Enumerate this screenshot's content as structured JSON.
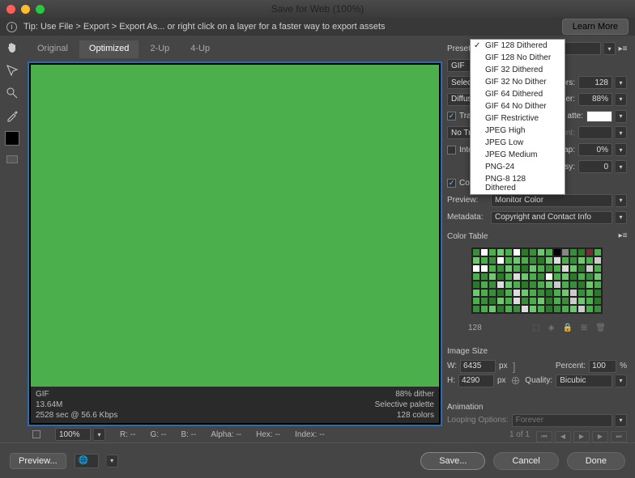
{
  "window": {
    "title": "Save for Web (100%)"
  },
  "tipbar": {
    "text": "Tip: Use File > Export > Export As...  or right click on a layer for a faster way to export assets",
    "learn": "Learn More"
  },
  "tabs": {
    "original": "Original",
    "optimized": "Optimized",
    "two_up": "2-Up",
    "four_up": "4-Up"
  },
  "canvas_info": {
    "format": "GIF",
    "size": "13.64M",
    "time": "2528 sec @ 56.6 Kbps",
    "dither": "88% dither",
    "palette": "Selective palette",
    "colors": "128 colors"
  },
  "readout": {
    "zoom": "100%",
    "r": "R:  --",
    "g": "G:  --",
    "b": "B:  --",
    "alpha": "Alpha:  --",
    "hex": "Hex:  --",
    "index": "Index:  --"
  },
  "preset": {
    "label": "Preset:",
    "format": "GIF",
    "selective_lbl": "Selective",
    "colors_lbl": "ors:",
    "colors_val": "128",
    "diffusion_lbl": "Diffusion",
    "dither_lbl": "her:",
    "dither_val": "88%",
    "transparency_lbl": "Transparency",
    "matte_lbl": "atte:",
    "no_trans_lbl": "No Transparency",
    "amount_lbl": "unt:",
    "interlaced_lbl": "Interlaced",
    "websnap_lbl": "nap:",
    "websnap_val": "0%",
    "lossy_lbl": "ssy:",
    "lossy_val": "0",
    "srgb_lbl": "Convert to sRGB",
    "preview_lbl": "Preview:",
    "preview_val": "Monitor Color",
    "metadata_lbl": "Metadata:",
    "metadata_val": "Copyright and Contact Info"
  },
  "colortable": {
    "header": "Color Table",
    "count": "128"
  },
  "imagesize": {
    "header": "Image Size",
    "w_lbl": "W:",
    "w_val": "6435",
    "px": "px",
    "h_lbl": "H:",
    "h_val": "4290",
    "percent_lbl": "Percent:",
    "percent_val": "100",
    "percent_unit": "%",
    "quality_lbl": "Quality:",
    "quality_val": "Bicubic"
  },
  "animation": {
    "header": "Animation",
    "loop_lbl": "Looping Options:",
    "loop_val": "Forever",
    "count": "1 of 1"
  },
  "footer": {
    "preview": "Preview...",
    "save": "Save...",
    "cancel": "Cancel",
    "done": "Done"
  },
  "dropdown": {
    "items": [
      "GIF 128 Dithered",
      "GIF 128 No Dither",
      "GIF 32 Dithered",
      "GIF 32 No Dither",
      "GIF 64 Dithered",
      "GIF 64 No Dither",
      "GIF Restrictive",
      "JPEG High",
      "JPEG Low",
      "JPEG Medium",
      "PNG-24",
      "PNG-8 128 Dithered"
    ],
    "selected": 0
  },
  "ct_colors": [
    "#3a8d3a",
    "#fff",
    "#4bb04b",
    "#6fc76f",
    "#4bb04b",
    "#fff",
    "#2a7a2a",
    "#3a8d3a",
    "#6fc76f",
    "#4bb04b",
    "#000",
    "#888",
    "#3a8d3a",
    "#2a7a2a",
    "#703030",
    "#4bb04b",
    "#6fc76f",
    "#4bb04b",
    "#3a8d3a",
    "#fff",
    "#4bb04b",
    "#6fc76f",
    "#4bb04b",
    "#3a8d3a",
    "#2a7a2a",
    "#6fc76f",
    "#ddd",
    "#4bb04b",
    "#3a8d3a",
    "#6fc76f",
    "#4bb04b",
    "#ccc",
    "#fff",
    "#fff",
    "#4bb04b",
    "#3a8d3a",
    "#6fc76f",
    "#4bb04b",
    "#2a7a2a",
    "#6fc76f",
    "#4bb04b",
    "#3a8d3a",
    "#4bb04b",
    "#ddd",
    "#6fc76f",
    "#2a7a2a",
    "#ccc",
    "#4bb04b",
    "#4bb04b",
    "#3a8d3a",
    "#6fc76f",
    "#2a7a2a",
    "#4bb04b",
    "#ddd",
    "#6fc76f",
    "#4bb04b",
    "#3a8d3a",
    "#fff",
    "#4bb04b",
    "#6fc76f",
    "#2a7a2a",
    "#4bb04b",
    "#3a8d3a",
    "#6fc76f",
    "#2a7a2a",
    "#4bb04b",
    "#3a8d3a",
    "#ddd",
    "#6fc76f",
    "#4bb04b",
    "#2a7a2a",
    "#3a8d3a",
    "#4bb04b",
    "#6fc76f",
    "#ccc",
    "#4bb04b",
    "#3a8d3a",
    "#2a7a2a",
    "#6fc76f",
    "#4bb04b",
    "#6fc76f",
    "#4bb04b",
    "#3a8d3a",
    "#2a7a2a",
    "#4bb04b",
    "#ddd",
    "#6fc76f",
    "#4bb04b",
    "#3a8d3a",
    "#2a7a2a",
    "#4bb04b",
    "#6fc76f",
    "#ccc",
    "#3a8d3a",
    "#4bb04b",
    "#2a7a2a",
    "#4bb04b",
    "#3a8d3a",
    "#2a7a2a",
    "#6fc76f",
    "#4bb04b",
    "#ddd",
    "#3a8d3a",
    "#4bb04b",
    "#6fc76f",
    "#2a7a2a",
    "#4bb04b",
    "#3a8d3a",
    "#ccc",
    "#6fc76f",
    "#4bb04b",
    "#2a7a2a",
    "#3a8d3a",
    "#4bb04b",
    "#6fc76f",
    "#2a7a2a",
    "#4bb04b",
    "#3a8d3a",
    "#ddd",
    "#6fc76f",
    "#4bb04b",
    "#2a7a2a",
    "#3a8d3a",
    "#4bb04b",
    "#6fc76f",
    "#ccc",
    "#4bb04b",
    "#3a8d3a"
  ]
}
